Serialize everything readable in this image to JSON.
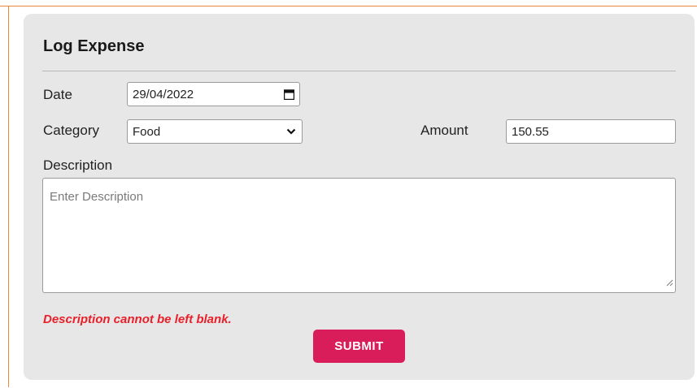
{
  "form": {
    "title": "Log Expense",
    "date": {
      "label": "Date",
      "value": "29/04/2022"
    },
    "category": {
      "label": "Category",
      "selected": "Food"
    },
    "amount": {
      "label": "Amount",
      "value": "150.55"
    },
    "description": {
      "label": "Description",
      "placeholder": "Enter Description",
      "value": ""
    },
    "error_message": "Description cannot be left blank.",
    "submit_label": "SUBMIT"
  },
  "icons": {
    "date_picker": "calendar-icon",
    "category_dropdown": "chevron-down-icon",
    "textarea_resize": "resize-grip-icon"
  },
  "colors": {
    "frame_accent": "#e8873a",
    "card_background": "#e8e7e8",
    "error_text": "#e8202a",
    "submit_button": "#d91d5a"
  }
}
